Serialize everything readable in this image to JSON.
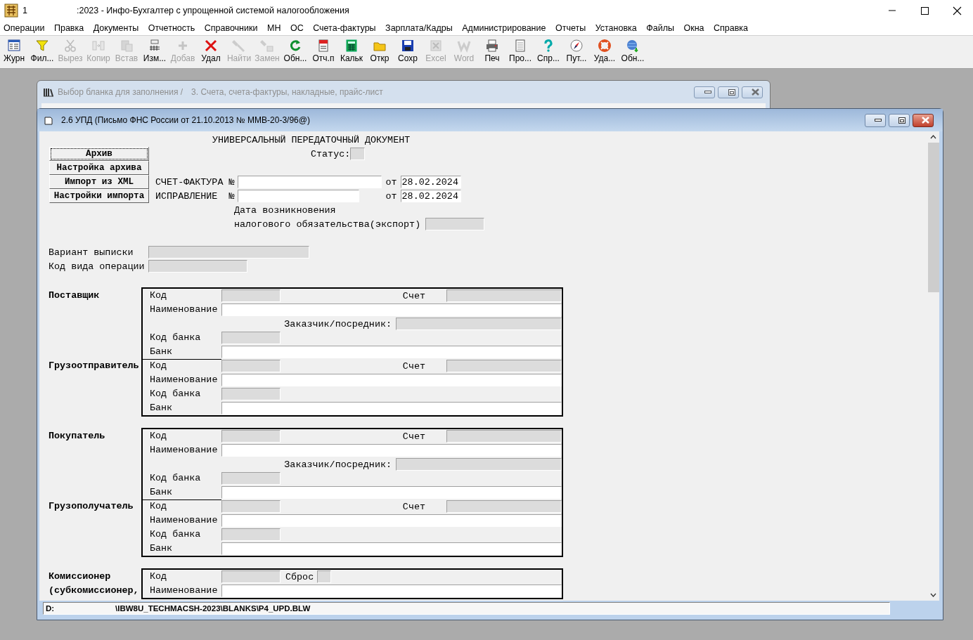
{
  "window": {
    "title_prefix": "1",
    "title": ":2023 - Инфо-Бухгалтер с упрощенной системой налогообложения"
  },
  "menu": [
    "Операции",
    "Правка",
    "Документы",
    "Отчетность",
    "Справочники",
    "МН",
    "ОС",
    "Счета-фактуры",
    "Зарплата/Кадры",
    "Администрирование",
    "Отчеты",
    "Установка",
    "Файлы",
    "Окна",
    "Справка"
  ],
  "toolbar": [
    {
      "label": "Журн",
      "disabled": false
    },
    {
      "label": "Фил...",
      "disabled": false
    },
    {
      "label": "Вырез",
      "disabled": true
    },
    {
      "label": "Копир",
      "disabled": true
    },
    {
      "label": "Встав",
      "disabled": true
    },
    {
      "label": "Изм...",
      "disabled": false
    },
    {
      "label": "Добав",
      "disabled": true
    },
    {
      "label": "Удал",
      "disabled": false
    },
    {
      "label": "Найти",
      "disabled": true
    },
    {
      "label": "Замен",
      "disabled": true
    },
    {
      "label": "Обн...",
      "disabled": false
    },
    {
      "label": "Отч.п",
      "disabled": false
    },
    {
      "label": "Кальк",
      "disabled": false
    },
    {
      "label": "Откр",
      "disabled": false
    },
    {
      "label": "Сохр",
      "disabled": false
    },
    {
      "label": "Excel",
      "disabled": true
    },
    {
      "label": "Word",
      "disabled": true
    },
    {
      "label": "Печ",
      "disabled": false
    },
    {
      "label": "Про...",
      "disabled": false
    },
    {
      "label": "Спр...",
      "disabled": false
    },
    {
      "label": "Пут...",
      "disabled": false
    },
    {
      "label": "Уда...",
      "disabled": false
    },
    {
      "label": "Обн...",
      "disabled": false
    }
  ],
  "background_window": {
    "title": "Выбор бланка для заполнения /",
    "subtitle": "3. Счета, счета-фактуры, накладные, прайс-лист"
  },
  "document_window": {
    "title": "2.6 УПД (Письмо ФНС России от 21.10.2013 № ММВ-20-3/96@)"
  },
  "form": {
    "heading": "УНИВЕРСАЛЬНЫЙ ПЕРЕДАТОЧНЫЙ ДОКУМЕНТ",
    "buttons": [
      {
        "label": "Архив",
        "focused": true
      },
      {
        "label": "Настройка архива",
        "focused": false
      },
      {
        "label": "Импорт из XML",
        "focused": false
      },
      {
        "label": "Настройки импорта",
        "focused": false
      }
    ],
    "status_label": "Статус:",
    "invoice": {
      "label": "СЧЕТ-ФАКТУРА №",
      "date_label": "от",
      "date": "28.02.2024"
    },
    "correction": {
      "label": "ИСПРАВЛЕНИЕ  №",
      "date_label": "от",
      "date": "28.02.2024"
    },
    "tax_date_label": "Дата возникновения",
    "tax_date_label_2": "налогового обязательства(экспорт)",
    "variant_label": "Вариант выписки",
    "operation_label": "Код вида операции",
    "blocks": [
      {
        "parties": [
          {
            "name": [
              "Поставщик"
            ],
            "rows": [
              {
                "kind": "code",
                "label": "Код",
                "account_label": "Счет"
              },
              {
                "kind": "name",
                "label": "Наименование"
              },
              {
                "kind": "customer",
                "label": "Заказчик/посредник:"
              },
              {
                "kind": "bank_code",
                "label": "Код банка"
              },
              {
                "kind": "bank",
                "label": "Банк"
              }
            ]
          },
          {
            "name": [
              "Грузоотправитель"
            ],
            "rows": [
              {
                "kind": "code",
                "label": "Код",
                "account_label": "Счет"
              },
              {
                "kind": "name",
                "label": "Наименование"
              },
              {
                "kind": "bank_code",
                "label": "Код банка"
              },
              {
                "kind": "bank",
                "label": "Банк"
              }
            ]
          }
        ]
      },
      {
        "parties": [
          {
            "name": [
              "Покупатель"
            ],
            "rows": [
              {
                "kind": "code",
                "label": "Код",
                "account_label": "Счет"
              },
              {
                "kind": "name",
                "label": "Наименование"
              },
              {
                "kind": "customer",
                "label": "Заказчик/посредник:"
              },
              {
                "kind": "bank_code",
                "label": "Код банка"
              },
              {
                "kind": "bank",
                "label": "Банк"
              }
            ]
          },
          {
            "name": [
              "Грузополучатель"
            ],
            "rows": [
              {
                "kind": "code",
                "label": "Код",
                "account_label": "Счет"
              },
              {
                "kind": "name",
                "label": "Наименование"
              },
              {
                "kind": "bank_code",
                "label": "Код банка"
              },
              {
                "kind": "bank",
                "label": "Банк"
              }
            ]
          }
        ]
      },
      {
        "parties": [
          {
            "name": [
              "Комиссионер",
              "(субкомиссионер,"
            ],
            "rows": [
              {
                "kind": "code_reset",
                "label": "Код",
                "reset_label": "Сброс"
              },
              {
                "kind": "name",
                "label": "Наименование"
              }
            ]
          }
        ]
      }
    ]
  },
  "status_bar": {
    "drive": "D:",
    "path": "\\IBW8U_TECHMACSH-2023\\BLANKS\\P4_UPD.BLW"
  }
}
